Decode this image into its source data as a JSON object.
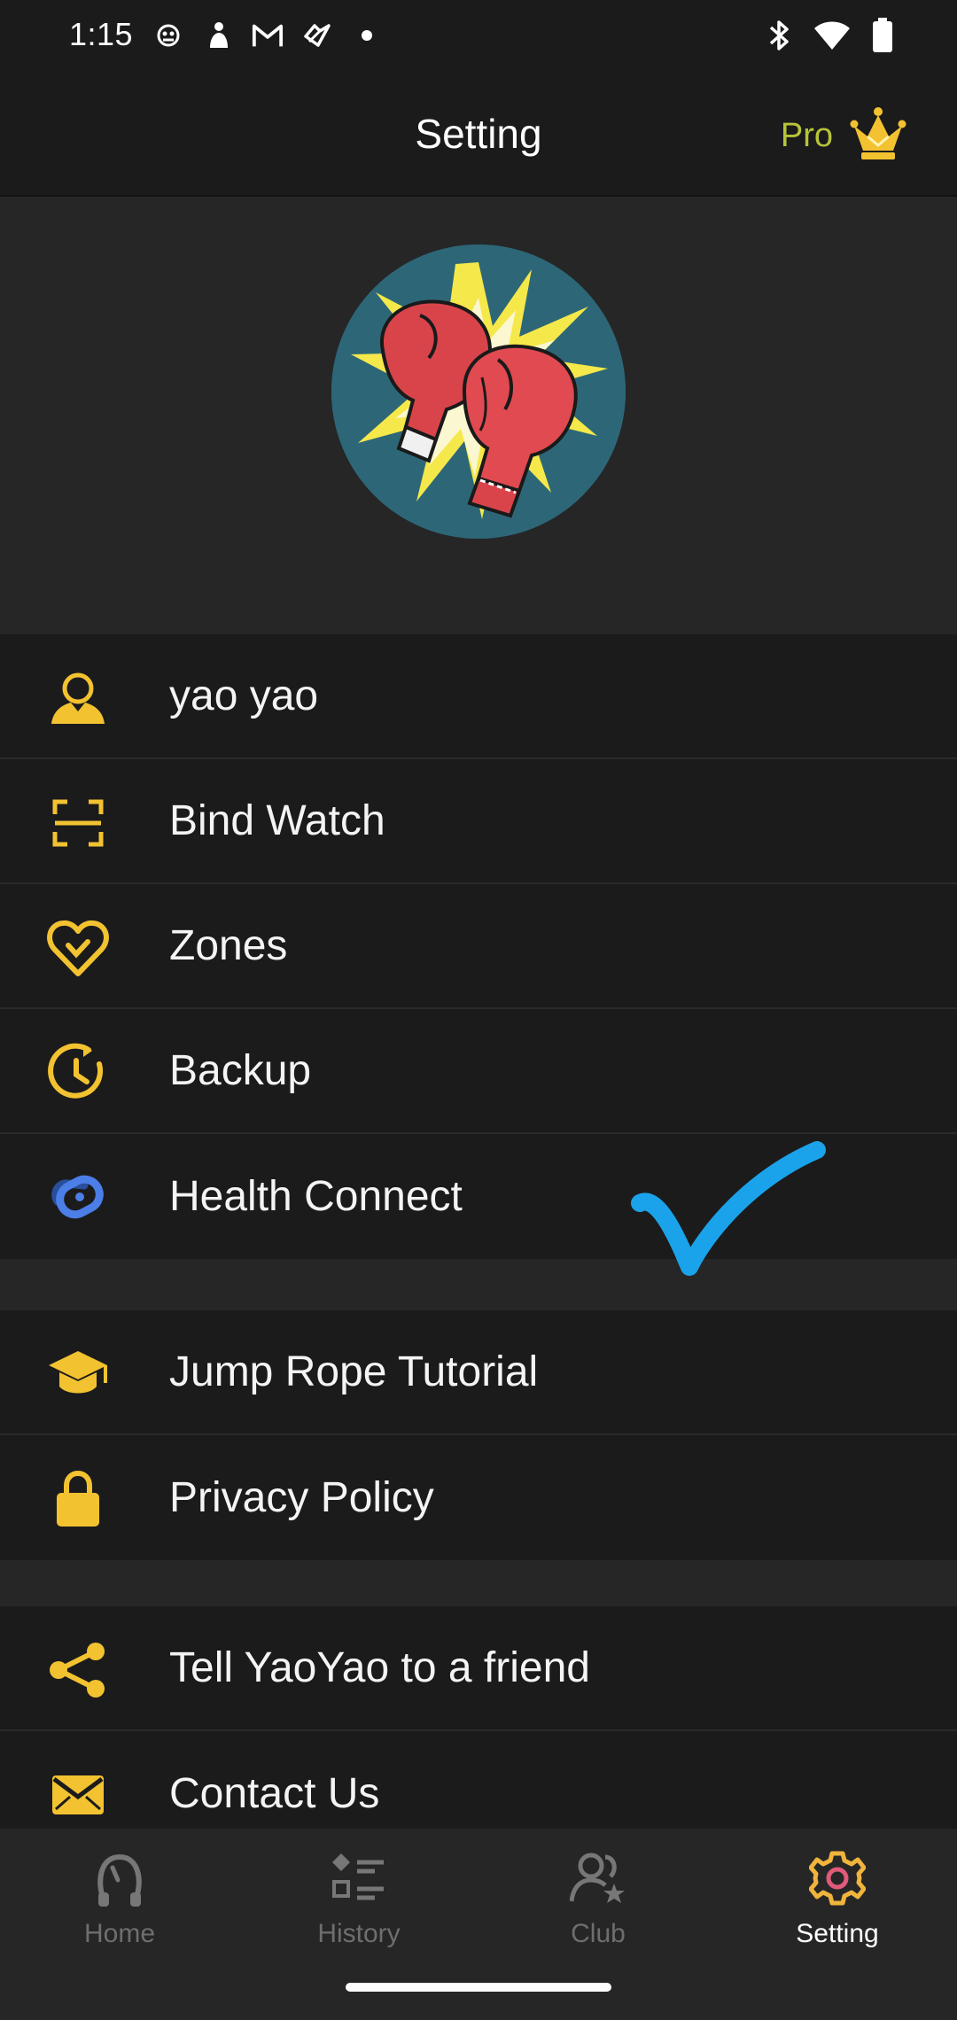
{
  "status_bar": {
    "time": "1:15",
    "left_icons": [
      "game-notification-icon",
      "figure-notification-icon",
      "gmail-icon",
      "health-notification-icon",
      "dot-icon"
    ],
    "right_icons": [
      "bluetooth-icon",
      "wifi-icon",
      "battery-icon"
    ]
  },
  "app_bar": {
    "title": "Setting",
    "pro_label": "Pro",
    "pro_icon": "crown-icon"
  },
  "profile": {
    "avatar": "boxing-gloves-avatar"
  },
  "menu_group_1": [
    {
      "label": "yao yao",
      "icon": "person-icon"
    },
    {
      "label": "Bind Watch",
      "icon": "scan-frame-icon"
    },
    {
      "label": "Zones",
      "icon": "heart-icon"
    },
    {
      "label": "Backup",
      "icon": "clock-backup-icon"
    },
    {
      "label": "Health Connect",
      "icon": "health-connect-icon"
    }
  ],
  "menu_group_2": [
    {
      "label": "Jump Rope Tutorial",
      "icon": "graduation-cap-icon"
    },
    {
      "label": "Privacy Policy",
      "icon": "lock-icon"
    }
  ],
  "menu_group_3": [
    {
      "label": "Tell YaoYao to a friend",
      "icon": "share-icon"
    },
    {
      "label": "Contact Us",
      "icon": "mail-icon"
    }
  ],
  "bottom_nav": [
    {
      "label": "Home",
      "icon": "jump-rope-icon",
      "active": false
    },
    {
      "label": "History",
      "icon": "list-icon",
      "active": false
    },
    {
      "label": "Club",
      "icon": "users-icon",
      "active": false
    },
    {
      "label": "Setting",
      "icon": "settings-gear-icon",
      "active": true
    }
  ],
  "colors": {
    "background": "#1b1b1c",
    "section_bg": "#262627",
    "accent_yellow": "#f2c230",
    "pro_green": "#b7c43a",
    "checkmark_blue": "#1aa3ea",
    "active_gear": "#f0b43c"
  }
}
